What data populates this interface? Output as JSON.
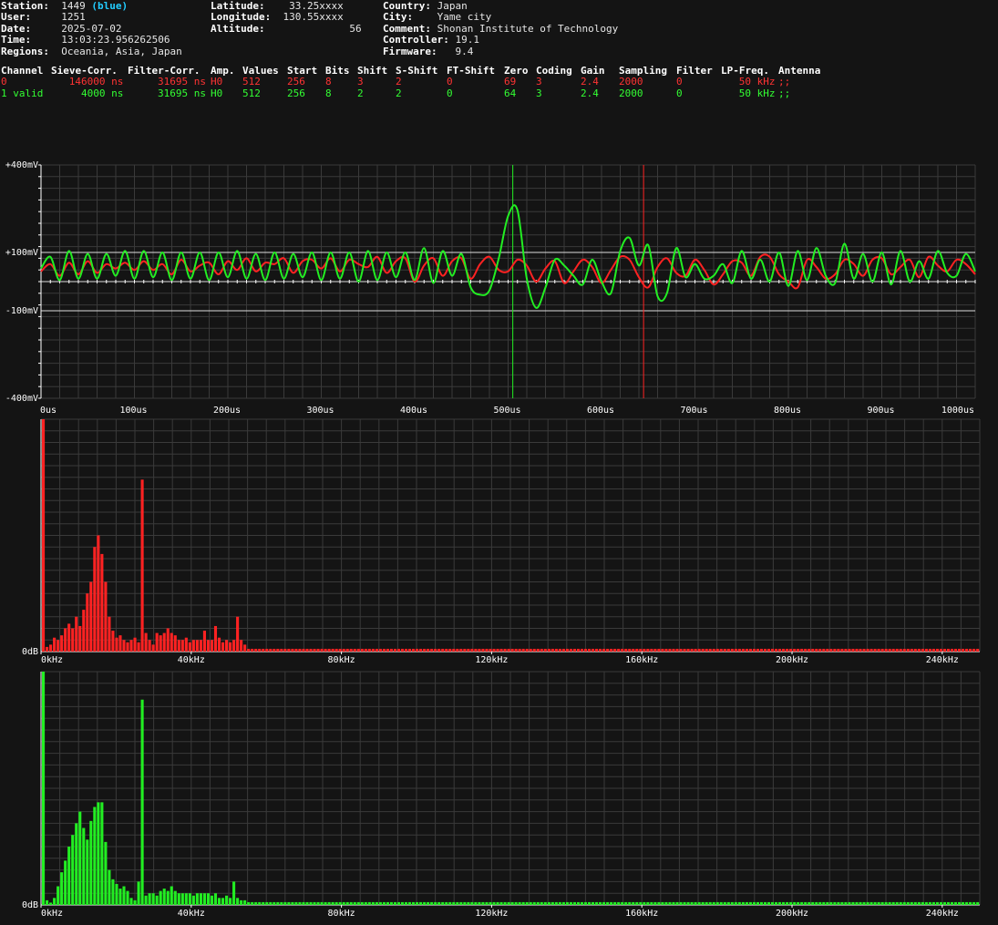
{
  "station": {
    "station_label": "Station:",
    "station_value": "1449",
    "station_color": "(blue)",
    "user_label": "User:",
    "user_value": "1251",
    "date_label": "Date:",
    "date_value": "2025-07-02",
    "time_label": "Time:",
    "time_value": "13:03:23.956262506",
    "regions_label": "Regions:",
    "regions_value": "Oceania, Asia, Japan"
  },
  "location": {
    "lat_label": "Latitude:",
    "lat_value": "33.25xxxx",
    "lon_label": "Longitude:",
    "lon_value": "130.55xxxx",
    "alt_label": "Altitude:",
    "alt_value": "56"
  },
  "site": {
    "country_label": "Country:",
    "country_value": "Japan",
    "city_label": "City:",
    "city_value": "Yame city",
    "comment_label": "Comment:",
    "comment_value": "Shonan Institute of Technology",
    "controller_label": "Controller:",
    "controller_value": "19.1",
    "firmware_label": "Firmware:",
    "firmware_value": "9.4"
  },
  "channel_table": {
    "headers": [
      "Channel",
      "Sieve-Corr.",
      "Filter-Corr.",
      "Amp.",
      "Values",
      "Start",
      "Bits",
      "Shift",
      "S-Shift",
      "FT-Shift",
      "Zero",
      "Coding",
      "Gain",
      "Sampling",
      "Filter",
      "LP-Freq.",
      "Antenna"
    ],
    "rows": [
      {
        "color": "#ff3333",
        "cells": [
          "0",
          "146000 ns",
          "31695 ns",
          "H0",
          "512",
          "256",
          "8",
          "3",
          "2",
          "0",
          "69",
          "3",
          "2.4",
          "2000",
          "0",
          "50 kHz",
          ";;"
        ]
      },
      {
        "color": "#33ff33",
        "cells": [
          "1 valid",
          "4000 ns",
          "31695 ns",
          "H0",
          "512",
          "256",
          "8",
          "2",
          "2",
          "0",
          "64",
          "3",
          "2.4",
          "2000",
          "0",
          "50 kHz",
          ";;"
        ]
      }
    ]
  },
  "colors": {
    "background": "#141414",
    "grid": "#3a3a3a",
    "channel0": "#ff2222",
    "channel1": "#22ee22",
    "axis": "#ffffff"
  },
  "chart_data": [
    {
      "type": "line",
      "x_unit": "us",
      "y_unit": "mV",
      "xlim": [
        0,
        1000
      ],
      "ylim": [
        -400,
        400
      ],
      "x_ticks": [
        "0us",
        "100us",
        "200us",
        "300us",
        "400us",
        "500us",
        "600us",
        "700us",
        "800us",
        "900us",
        "1000us"
      ],
      "y_ticks": [
        "+400mV",
        "+100mV",
        "-100mV",
        "-400mV"
      ],
      "reference_lines_mV": [
        100,
        0,
        -100
      ],
      "markers_us": [
        {
          "channel": 1,
          "x": 505
        },
        {
          "channel": 0,
          "x": 645
        }
      ],
      "series": [
        {
          "channel": 0,
          "color": "#ff2222",
          "x": [
            0,
            10,
            20,
            30,
            40,
            50,
            60,
            70,
            80,
            90,
            100,
            110,
            120,
            130,
            140,
            150,
            160,
            170,
            180,
            190,
            200,
            210,
            220,
            230,
            240,
            250,
            260,
            270,
            280,
            290,
            300,
            310,
            320,
            330,
            340,
            350,
            360,
            370,
            380,
            390,
            400,
            410,
            420,
            430,
            440,
            450,
            460,
            470,
            480,
            490,
            500,
            510,
            520,
            530,
            540,
            550,
            560,
            570,
            580,
            590,
            600,
            610,
            620,
            630,
            640,
            650,
            660,
            670,
            680,
            690,
            700,
            710,
            720,
            730,
            740,
            750,
            760,
            770,
            780,
            790,
            800,
            810,
            820,
            830,
            840,
            850,
            860,
            870,
            880,
            890,
            900,
            910,
            920,
            930,
            940,
            950,
            960,
            970,
            980,
            990,
            1000
          ],
          "y": [
            35,
            60,
            20,
            65,
            25,
            70,
            30,
            60,
            45,
            65,
            40,
            70,
            40,
            60,
            25,
            75,
            35,
            55,
            65,
            25,
            70,
            40,
            80,
            35,
            65,
            60,
            80,
            30,
            70,
            75,
            45,
            80,
            35,
            75,
            60,
            50,
            85,
            30,
            70,
            80,
            0,
            55,
            80,
            20,
            70,
            80,
            10,
            60,
            85,
            40,
            35,
            75,
            55,
            0,
            45,
            70,
            -5,
            35,
            75,
            50,
            -5,
            40,
            85,
            75,
            15,
            -20,
            50,
            80,
            30,
            20,
            75,
            40,
            -10,
            25,
            70,
            65,
            20,
            85,
            85,
            25,
            0,
            -20,
            75,
            50,
            10,
            25,
            75,
            60,
            20,
            75,
            80,
            25,
            50,
            75,
            15,
            85,
            55,
            35,
            75,
            60,
            25
          ]
        },
        {
          "channel": 1,
          "color": "#22ee22",
          "x": [
            0,
            10,
            20,
            30,
            40,
            50,
            60,
            70,
            80,
            90,
            100,
            110,
            120,
            130,
            140,
            150,
            160,
            170,
            180,
            190,
            200,
            210,
            220,
            230,
            240,
            250,
            260,
            270,
            280,
            290,
            300,
            310,
            320,
            330,
            340,
            350,
            360,
            370,
            380,
            390,
            400,
            410,
            420,
            430,
            440,
            450,
            460,
            470,
            480,
            490,
            500,
            510,
            520,
            530,
            540,
            550,
            560,
            570,
            580,
            590,
            600,
            610,
            620,
            630,
            640,
            650,
            660,
            670,
            680,
            690,
            700,
            710,
            720,
            730,
            740,
            750,
            760,
            770,
            780,
            790,
            800,
            810,
            820,
            830,
            840,
            850,
            860,
            870,
            880,
            890,
            900,
            910,
            920,
            930,
            940,
            950,
            960,
            970,
            980,
            990,
            1000
          ],
          "y": [
            45,
            85,
            5,
            105,
            10,
            95,
            10,
            95,
            20,
            105,
            10,
            105,
            15,
            100,
            5,
            100,
            10,
            100,
            5,
            100,
            15,
            105,
            10,
            95,
            5,
            100,
            10,
            95,
            15,
            100,
            5,
            100,
            10,
            100,
            0,
            105,
            5,
            100,
            15,
            100,
            5,
            115,
            -5,
            105,
            20,
            95,
            -20,
            -45,
            -30,
            80,
            225,
            245,
            10,
            -90,
            -20,
            75,
            55,
            20,
            -10,
            75,
            0,
            -40,
            105,
            150,
            55,
            125,
            -50,
            -40,
            115,
            15,
            60,
            10,
            20,
            60,
            -5,
            105,
            10,
            75,
            0,
            100,
            -15,
            105,
            5,
            115,
            20,
            -5,
            130,
            10,
            95,
            0,
            100,
            -10,
            105,
            0,
            70,
            10,
            105,
            30,
            20,
            95,
            35
          ]
        }
      ]
    },
    {
      "type": "bar",
      "channel": 0,
      "color": "#ff2222",
      "x_unit": "kHz",
      "x_ticks": [
        "0kHz",
        "40kHz",
        "80kHz",
        "120kHz",
        "160kHz",
        "200kHz",
        "240kHz"
      ],
      "xlim": [
        0,
        250
      ],
      "y_label": "0dB",
      "ylim": [
        0,
        1
      ],
      "bin_width_khz": 1.0,
      "peaks": [
        [
          0,
          1.0
        ],
        [
          1,
          0.02
        ],
        [
          2,
          0.03
        ],
        [
          3,
          0.06
        ],
        [
          4,
          0.05
        ],
        [
          5,
          0.07
        ],
        [
          6,
          0.1
        ],
        [
          7,
          0.12
        ],
        [
          8,
          0.1
        ],
        [
          9,
          0.15
        ],
        [
          10,
          0.11
        ],
        [
          11,
          0.18
        ],
        [
          12,
          0.25
        ],
        [
          13,
          0.3
        ],
        [
          14,
          0.45
        ],
        [
          15,
          0.5
        ],
        [
          16,
          0.42
        ],
        [
          17,
          0.3
        ],
        [
          18,
          0.15
        ],
        [
          19,
          0.09
        ],
        [
          20,
          0.06
        ],
        [
          21,
          0.07
        ],
        [
          22,
          0.05
        ],
        [
          23,
          0.04
        ],
        [
          24,
          0.05
        ],
        [
          25,
          0.06
        ],
        [
          26,
          0.04
        ],
        [
          27,
          0.74
        ],
        [
          28,
          0.08
        ],
        [
          29,
          0.05
        ],
        [
          30,
          0.03
        ],
        [
          31,
          0.08
        ],
        [
          32,
          0.07
        ],
        [
          33,
          0.08
        ],
        [
          34,
          0.1
        ],
        [
          35,
          0.08
        ],
        [
          36,
          0.07
        ],
        [
          37,
          0.05
        ],
        [
          38,
          0.05
        ],
        [
          39,
          0.06
        ],
        [
          40,
          0.04
        ],
        [
          41,
          0.05
        ],
        [
          42,
          0.05
        ],
        [
          43,
          0.05
        ],
        [
          44,
          0.09
        ],
        [
          45,
          0.05
        ],
        [
          46,
          0.05
        ],
        [
          47,
          0.11
        ],
        [
          48,
          0.06
        ],
        [
          49,
          0.04
        ],
        [
          50,
          0.05
        ],
        [
          51,
          0.04
        ],
        [
          52,
          0.05
        ],
        [
          53,
          0.15
        ],
        [
          54,
          0.05
        ],
        [
          55,
          0.03
        ]
      ],
      "noise_floor": 0.012
    },
    {
      "type": "bar",
      "channel": 1,
      "color": "#22ee22",
      "x_unit": "kHz",
      "x_ticks": [
        "0kHz",
        "40kHz",
        "80kHz",
        "120kHz",
        "160kHz",
        "200kHz",
        "240kHz"
      ],
      "xlim": [
        0,
        250
      ],
      "y_label": "0dB",
      "ylim": [
        0,
        1
      ],
      "bin_width_khz": 1.0,
      "peaks": [
        [
          0,
          1.0
        ],
        [
          1,
          0.02
        ],
        [
          2,
          0.01
        ],
        [
          3,
          0.03
        ],
        [
          4,
          0.08
        ],
        [
          5,
          0.14
        ],
        [
          6,
          0.19
        ],
        [
          7,
          0.25
        ],
        [
          8,
          0.3
        ],
        [
          9,
          0.35
        ],
        [
          10,
          0.4
        ],
        [
          11,
          0.33
        ],
        [
          12,
          0.28
        ],
        [
          13,
          0.36
        ],
        [
          14,
          0.42
        ],
        [
          15,
          0.44
        ],
        [
          16,
          0.44
        ],
        [
          17,
          0.27
        ],
        [
          18,
          0.15
        ],
        [
          19,
          0.11
        ],
        [
          20,
          0.09
        ],
        [
          21,
          0.07
        ],
        [
          22,
          0.08
        ],
        [
          23,
          0.06
        ],
        [
          24,
          0.03
        ],
        [
          25,
          0.02
        ],
        [
          26,
          0.1
        ],
        [
          27,
          0.88
        ],
        [
          28,
          0.04
        ],
        [
          29,
          0.05
        ],
        [
          30,
          0.05
        ],
        [
          31,
          0.04
        ],
        [
          32,
          0.06
        ],
        [
          33,
          0.07
        ],
        [
          34,
          0.06
        ],
        [
          35,
          0.08
        ],
        [
          36,
          0.06
        ],
        [
          37,
          0.05
        ],
        [
          38,
          0.05
        ],
        [
          39,
          0.05
        ],
        [
          40,
          0.05
        ],
        [
          41,
          0.04
        ],
        [
          42,
          0.05
        ],
        [
          43,
          0.05
        ],
        [
          44,
          0.05
        ],
        [
          45,
          0.05
        ],
        [
          46,
          0.04
        ],
        [
          47,
          0.05
        ],
        [
          48,
          0.03
        ],
        [
          49,
          0.03
        ],
        [
          50,
          0.04
        ],
        [
          51,
          0.03
        ],
        [
          52,
          0.1
        ],
        [
          53,
          0.03
        ],
        [
          54,
          0.02
        ],
        [
          55,
          0.02
        ]
      ],
      "noise_floor": 0.012
    }
  ]
}
